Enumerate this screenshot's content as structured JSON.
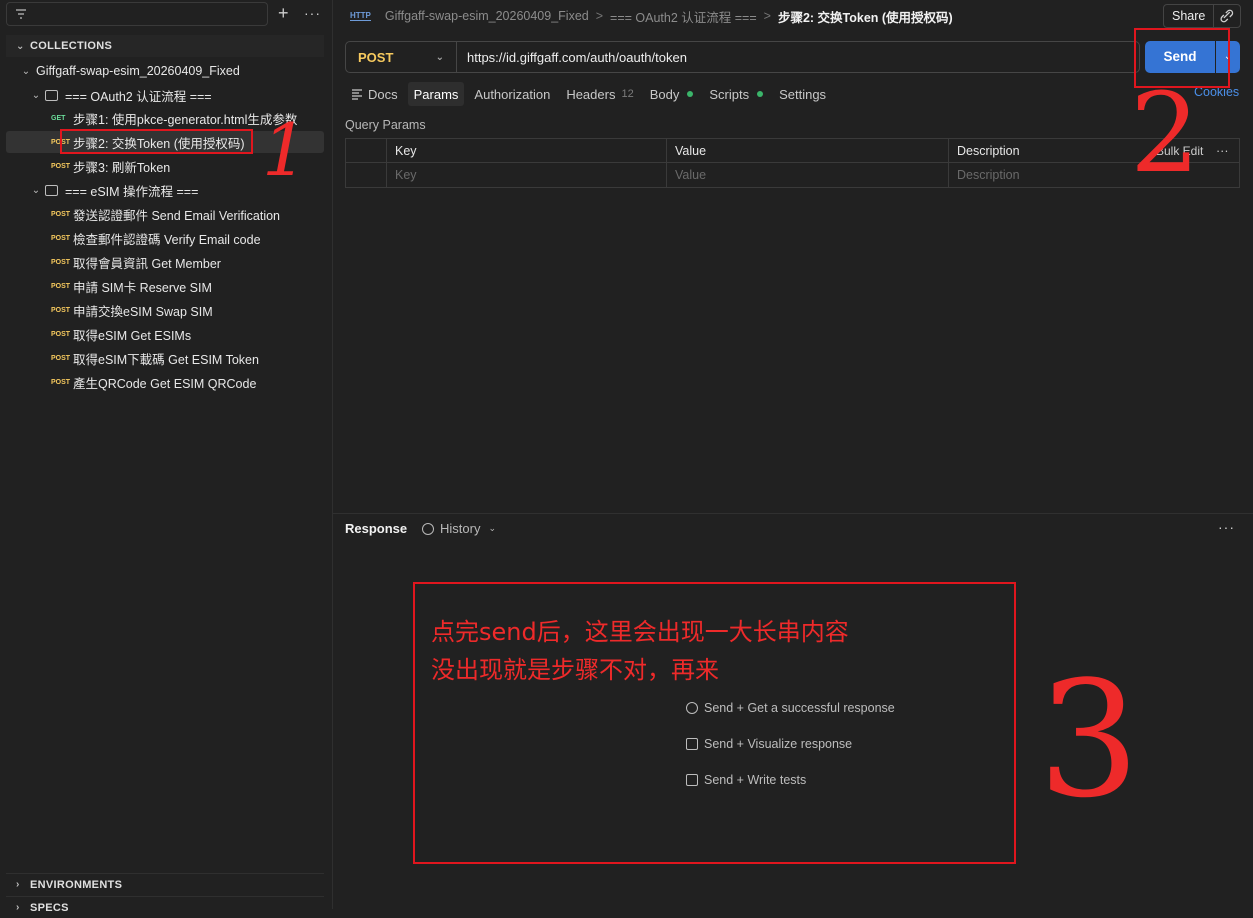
{
  "sidebar": {
    "collections_label": "COLLECTIONS",
    "collection_name": "Giffgaff-swap-esim_20260409_Fixed",
    "folder1": "=== OAuth2 认证流程 ===",
    "folder1_items": [
      {
        "method": "GET",
        "label": "步骤1: 使用pkce-generator.html生成参数"
      },
      {
        "method": "POST",
        "label": "步骤2: 交换Token (使用授权码)"
      },
      {
        "method": "POST",
        "label": "步骤3: 刷新Token"
      }
    ],
    "folder2": "=== eSIM 操作流程 ===",
    "folder2_items": [
      {
        "method": "POST",
        "label": "發送認證郵件 Send Email Verification"
      },
      {
        "method": "POST",
        "label": "檢查郵件認證碼 Verify Email code"
      },
      {
        "method": "POST",
        "label": "取得會員資訊 Get Member"
      },
      {
        "method": "POST",
        "label": "申請 SIM卡 Reserve SIM"
      },
      {
        "method": "POST",
        "label": "申請交換eSIM Swap SIM"
      },
      {
        "method": "POST",
        "label": "取得eSIM Get ESIMs"
      },
      {
        "method": "POST",
        "label": "取得eSIM下載碼 Get ESIM Token"
      },
      {
        "method": "POST",
        "label": "產生QRCode Get ESIM QRCode"
      }
    ],
    "environments_label": "ENVIRONMENTS",
    "specs_label": "SPECS"
  },
  "header": {
    "http_badge": "HTTP",
    "crumb1": "Giffgaff-swap-esim_20260409_Fixed",
    "sep": ">",
    "crumb2": "=== OAuth2 认证流程 ===",
    "current": "步骤2: 交换Token (使用授权码)",
    "share_label": "Share"
  },
  "request": {
    "method": "POST",
    "url": "https://id.giffgaff.com/auth/oauth/token",
    "send_label": "Send"
  },
  "tabs": {
    "docs": "Docs",
    "params": "Params",
    "authorization": "Authorization",
    "headers": "Headers",
    "headers_count": "12",
    "body": "Body",
    "scripts": "Scripts",
    "settings": "Settings",
    "cookies": "Cookies"
  },
  "params": {
    "title": "Query Params",
    "col_key": "Key",
    "col_value": "Value",
    "col_description": "Description",
    "bulk_edit": "Bulk Edit",
    "ph_key": "Key",
    "ph_value": "Value",
    "ph_description": "Description"
  },
  "response": {
    "tab": "Response",
    "history": "History",
    "hints": [
      "Send + Get a successful response",
      "Send + Visualize response",
      "Send + Write tests"
    ]
  },
  "annotations": {
    "note_line1": "点完send后，这里会出现一大长串内容",
    "note_line2": "没出现就是步骤不对，再来",
    "n1": "1",
    "n2": "2",
    "n3": "3",
    "color": "#e0161e"
  }
}
